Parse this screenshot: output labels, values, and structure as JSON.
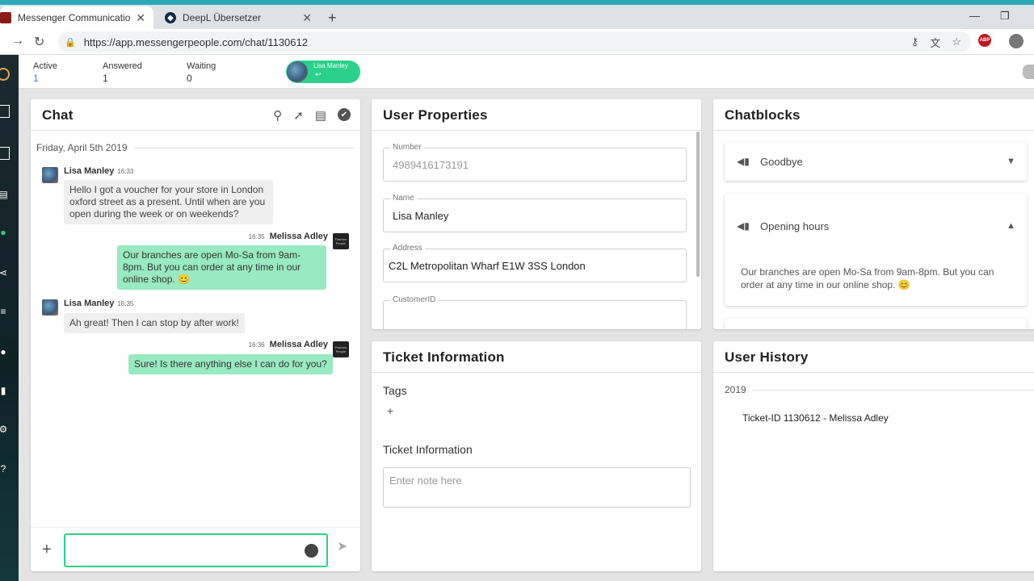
{
  "browser": {
    "tabs": [
      {
        "title": "Messenger Communication Platf…",
        "active": true
      },
      {
        "title": "DeepL Übersetzer",
        "active": false
      }
    ],
    "url": "https://app.messengerpeople.com/chat/1130612",
    "abp_label": "ABP"
  },
  "header": {
    "stats": [
      {
        "label": "Active",
        "value": "1"
      },
      {
        "label": "Answered",
        "value": "1"
      },
      {
        "label": "Waiting",
        "value": "0"
      }
    ],
    "user_pill": {
      "name": "Lisa Manley",
      "reply_icon": "↩"
    }
  },
  "chat": {
    "title": "Chat",
    "date": "Friday, April 5th 2019",
    "brand_label": "Fashion People",
    "messages": [
      {
        "sender": "Lisa Manley",
        "time": "16:33",
        "direction": "in",
        "text": "Hello I got a voucher for your store in London oxford street as a present. Until when are you open during the week or on weekends?"
      },
      {
        "sender": "Melissa Adley",
        "time": "16:35",
        "direction": "out",
        "text": "Our branches are open Mo-Sa from 9am-8pm. But you can order at any time in our online shop. 😊"
      },
      {
        "sender": "Lisa Manley",
        "time": "16:35",
        "direction": "in",
        "text": "Ah great! Then I can stop by after work!"
      },
      {
        "sender": "Melissa Adley",
        "time": "16:36",
        "direction": "out",
        "text": "Sure! Is there anything else I can do for you?"
      }
    ],
    "input_value": ""
  },
  "user_properties": {
    "title": "User Properties",
    "fields": {
      "number": {
        "label": "Number",
        "value": "4989416173191"
      },
      "name": {
        "label": "Name",
        "value": "Lisa Manley"
      },
      "address": {
        "label": "Address",
        "value": "C2L Metropolitan Wharf E1W 3SS London"
      },
      "customer_id": {
        "label": "CustomerID",
        "value": ""
      }
    }
  },
  "chatblocks": {
    "title": "Chatblocks",
    "items": [
      {
        "name": "Goodbye",
        "expanded": false
      },
      {
        "name": "Opening hours",
        "expanded": true,
        "body": "Our branches are open Mo-Sa from 9am-8pm. But you can order at any time in our online shop. 😊"
      }
    ]
  },
  "ticket_info": {
    "title": "Ticket Information",
    "tags_label": "Tags",
    "add_tag": "+",
    "info_label": "Ticket Information",
    "note_placeholder": "Enter note here"
  },
  "user_history": {
    "title": "User History",
    "year": "2019",
    "items": [
      "Ticket-ID 1130612 - Melissa Adley"
    ]
  },
  "colors": {
    "accent": "#2bd18a",
    "outgoing_bubble": "#98eac0",
    "topstrip": "#2aa9b8"
  }
}
